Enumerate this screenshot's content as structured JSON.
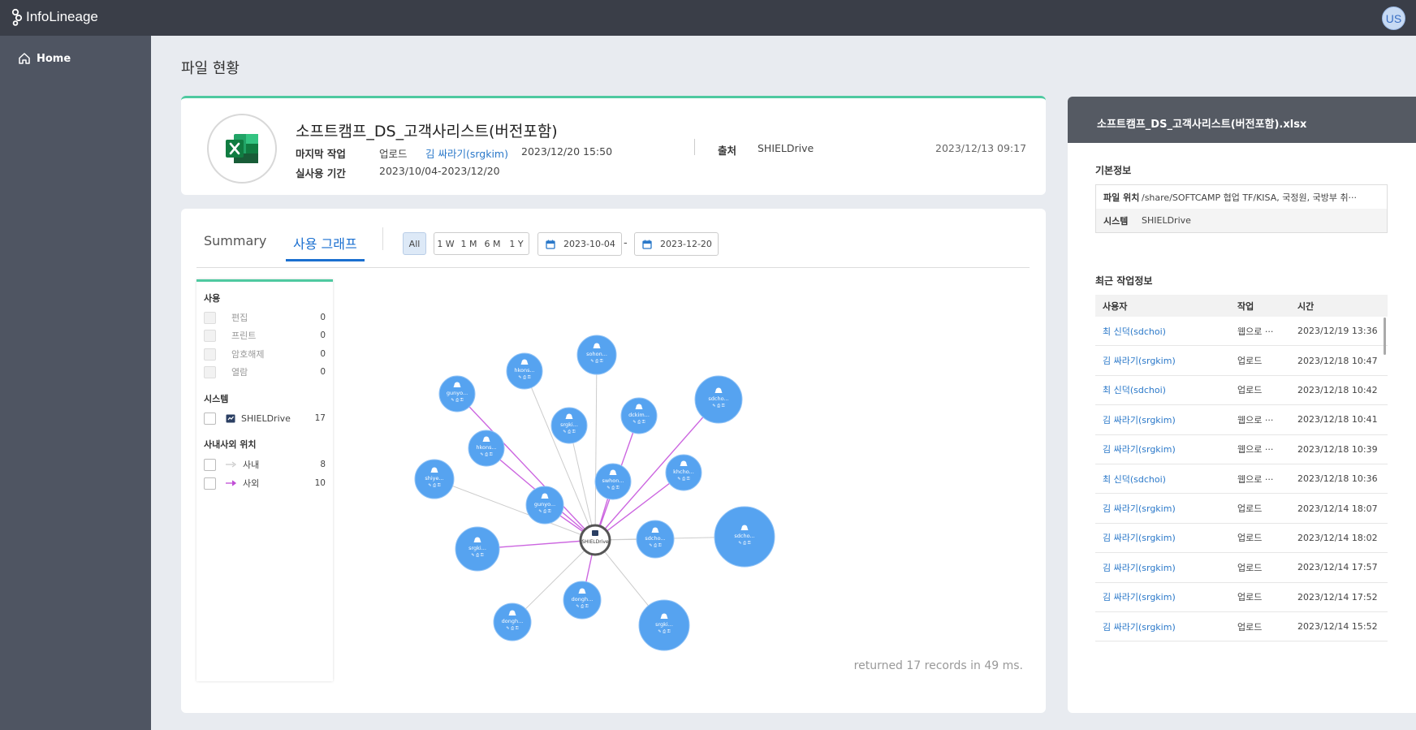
{
  "app": {
    "logo_text": "InfoLineage",
    "user_initials": "US"
  },
  "sidebar": {
    "items": [
      {
        "label": "Home",
        "icon": "home-icon"
      }
    ]
  },
  "page": {
    "title": "파일 현황"
  },
  "file": {
    "name": "소프트캠프_DS_고객사리스트(버전포함)",
    "icon": "excel-icon",
    "last_work_label": "마지막 작업",
    "last_work_action": "업로드",
    "last_work_user": "김 싸라기(srgkim)",
    "last_work_time": "2023/12/20 15:50",
    "period_label": "실사용 기간",
    "period_value": "2023/10/04-2023/12/20",
    "source_label": "출처",
    "source_value": "SHIELDrive",
    "date": "2023/12/13 09:17"
  },
  "graph": {
    "tabs": [
      {
        "label": "Summary",
        "active": false
      },
      {
        "label": "사용 그래프",
        "active": true
      }
    ],
    "ranges": [
      "All",
      "1 W",
      "1 M",
      "6 M",
      "1 Y"
    ],
    "selected_range": "All",
    "date_from": "2023-10-04",
    "date_to": "2023-12-20",
    "date_sep": "-",
    "records_text": "returned 17 records in 49 ms.",
    "center_label": "SHIELDrive",
    "node_color": "#56a3f0",
    "internal_edge_color": "#cccccc",
    "external_edge_color": "#cc66e0",
    "nodes": [
      {
        "label": "sohon...",
        "edge": "internal"
      },
      {
        "label": "hkons...",
        "edge": "internal"
      },
      {
        "label": "gunyo...",
        "edge": "external"
      },
      {
        "label": "sdcho...",
        "edge": "external"
      },
      {
        "label": "dckim...",
        "edge": "external"
      },
      {
        "label": "srgki...",
        "edge": "internal"
      },
      {
        "label": "hkons...",
        "edge": "external"
      },
      {
        "label": "khcho...",
        "edge": "external"
      },
      {
        "label": "shiye...",
        "edge": "internal"
      },
      {
        "label": "swhon...",
        "edge": "external"
      },
      {
        "label": "gunyo...",
        "edge": "external"
      },
      {
        "label": "sdcho...",
        "edge": "internal"
      },
      {
        "label": "sdcho...",
        "edge": "internal"
      },
      {
        "label": "srgki...",
        "edge": "external"
      },
      {
        "label": "dongh...",
        "edge": "external"
      },
      {
        "label": "dongh...",
        "edge": "internal"
      },
      {
        "label": "srgki...",
        "edge": "internal"
      }
    ]
  },
  "filters": {
    "usage": {
      "title": "사용",
      "items": [
        {
          "label": "편집",
          "count": "0"
        },
        {
          "label": "프린트",
          "count": "0"
        },
        {
          "label": "암호해제",
          "count": "0"
        },
        {
          "label": "열람",
          "count": "0"
        }
      ]
    },
    "system": {
      "title": "시스템",
      "items": [
        {
          "label": "SHIELDrive",
          "count": "17"
        }
      ]
    },
    "location": {
      "title": "사내사외 위치",
      "items": [
        {
          "label": "사내",
          "count": "8"
        },
        {
          "label": "사외",
          "count": "10"
        }
      ]
    }
  },
  "detail": {
    "header": "소프트캠프_DS_고객사리스트(버전포함).xlsx",
    "basic_title": "기본정보",
    "location_key": "파일 위치",
    "location_val": "/share/SOFTCAMP 협업 TF/KISA, 국정원, 국방부 취···",
    "system_key": "시스템",
    "system_val": "SHIELDrive",
    "recent_title": "최근 작업정보",
    "columns": [
      "사용자",
      "작업",
      "시간"
    ],
    "rows": [
      {
        "user": "최 신덕(sdchoi)",
        "action": "웹으로 ···",
        "time": "2023/12/19 13:36"
      },
      {
        "user": "김 싸라기(srgkim)",
        "action": "업로드",
        "time": "2023/12/18 10:47"
      },
      {
        "user": "최 신덕(sdchoi)",
        "action": "업로드",
        "time": "2023/12/18 10:42"
      },
      {
        "user": "김 싸라기(srgkim)",
        "action": "웹으로 ···",
        "time": "2023/12/18 10:41"
      },
      {
        "user": "김 싸라기(srgkim)",
        "action": "웹으로 ···",
        "time": "2023/12/18 10:39"
      },
      {
        "user": "최 신덕(sdchoi)",
        "action": "웹으로 ···",
        "time": "2023/12/18 10:36"
      },
      {
        "user": "김 싸라기(srgkim)",
        "action": "업로드",
        "time": "2023/12/14 18:07"
      },
      {
        "user": "김 싸라기(srgkim)",
        "action": "업로드",
        "time": "2023/12/14 18:02"
      },
      {
        "user": "김 싸라기(srgkim)",
        "action": "업로드",
        "time": "2023/12/14 17:57"
      },
      {
        "user": "김 싸라기(srgkim)",
        "action": "업로드",
        "time": "2023/12/14 17:52"
      },
      {
        "user": "김 싸라기(srgkim)",
        "action": "업로드",
        "time": "2023/12/14 15:52"
      }
    ]
  }
}
